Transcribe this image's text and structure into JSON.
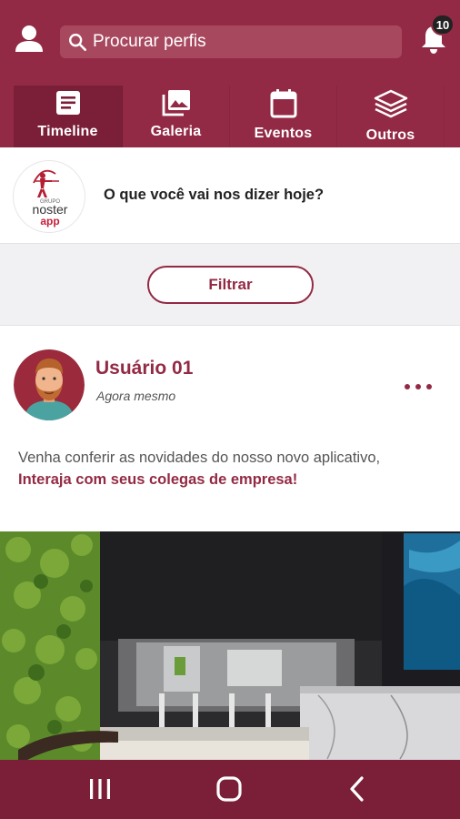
{
  "header": {
    "search_placeholder": "Procurar perfis",
    "notification_count": "10"
  },
  "tabs": [
    {
      "label": "Timeline",
      "icon": "article-icon",
      "active": true
    },
    {
      "label": "Galeria",
      "icon": "photo-library-icon",
      "active": false
    },
    {
      "label": "Eventos",
      "icon": "calendar-icon",
      "active": false
    },
    {
      "label": "Outros",
      "icon": "layers-icon",
      "active": false
    }
  ],
  "compose": {
    "logo_text_top": "GRUPO",
    "logo_text_mid": "noster",
    "logo_text_bottom": "app",
    "prompt": "O que você vai nos dizer hoje?"
  },
  "filter": {
    "label": "Filtrar"
  },
  "post": {
    "user": "Usuário 01",
    "time": "Agora mesmo",
    "text": "Venha conferir as novidades do nosso novo aplicativo,",
    "highlight": "Interaja com seus colegas de empresa!"
  },
  "colors": {
    "primary": "#932a45",
    "primary_dark": "#7a1f37",
    "search_bg": "#a8485f"
  }
}
